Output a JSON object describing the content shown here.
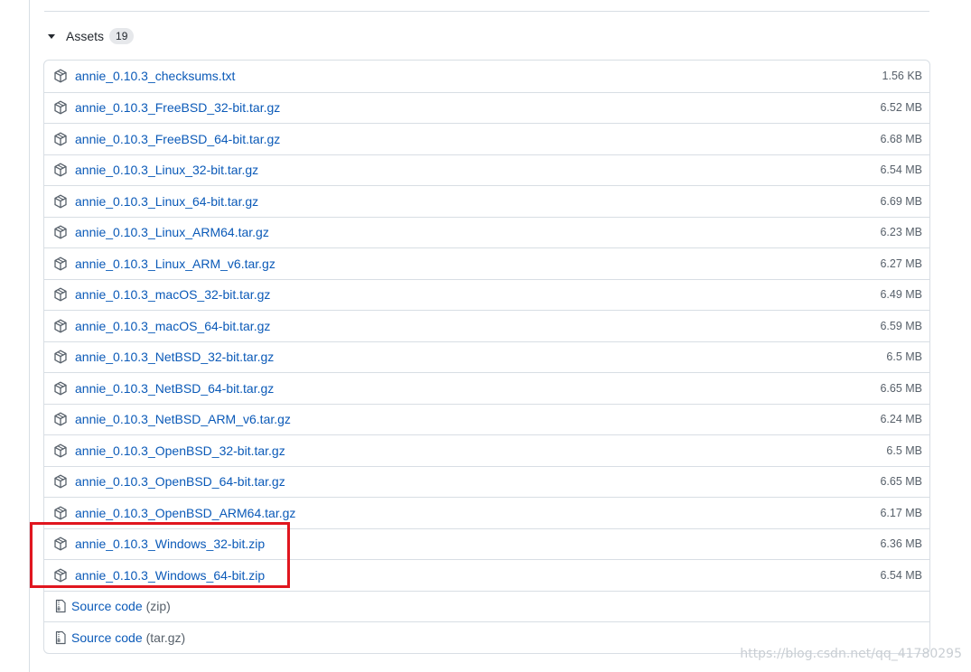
{
  "assets": {
    "title": "Assets",
    "count": "19",
    "files": [
      {
        "name": "annie_0.10.3_checksums.txt",
        "size": "1.56 KB"
      },
      {
        "name": "annie_0.10.3_FreeBSD_32-bit.tar.gz",
        "size": "6.52 MB"
      },
      {
        "name": "annie_0.10.3_FreeBSD_64-bit.tar.gz",
        "size": "6.68 MB"
      },
      {
        "name": "annie_0.10.3_Linux_32-bit.tar.gz",
        "size": "6.54 MB"
      },
      {
        "name": "annie_0.10.3_Linux_64-bit.tar.gz",
        "size": "6.69 MB"
      },
      {
        "name": "annie_0.10.3_Linux_ARM64.tar.gz",
        "size": "6.23 MB"
      },
      {
        "name": "annie_0.10.3_Linux_ARM_v6.tar.gz",
        "size": "6.27 MB"
      },
      {
        "name": "annie_0.10.3_macOS_32-bit.tar.gz",
        "size": "6.49 MB"
      },
      {
        "name": "annie_0.10.3_macOS_64-bit.tar.gz",
        "size": "6.59 MB"
      },
      {
        "name": "annie_0.10.3_NetBSD_32-bit.tar.gz",
        "size": "6.5 MB"
      },
      {
        "name": "annie_0.10.3_NetBSD_64-bit.tar.gz",
        "size": "6.65 MB"
      },
      {
        "name": "annie_0.10.3_NetBSD_ARM_v6.tar.gz",
        "size": "6.24 MB"
      },
      {
        "name": "annie_0.10.3_OpenBSD_32-bit.tar.gz",
        "size": "6.5 MB"
      },
      {
        "name": "annie_0.10.3_OpenBSD_64-bit.tar.gz",
        "size": "6.65 MB"
      },
      {
        "name": "annie_0.10.3_OpenBSD_ARM64.tar.gz",
        "size": "6.17 MB"
      },
      {
        "name": "annie_0.10.3_Windows_32-bit.zip",
        "size": "6.36 MB"
      },
      {
        "name": "annie_0.10.3_Windows_64-bit.zip",
        "size": "6.54 MB"
      }
    ],
    "source": [
      {
        "label": "Source code",
        "suffix": "(zip)"
      },
      {
        "label": "Source code",
        "suffix": "(tar.gz)"
      }
    ]
  },
  "icons": {
    "package": "package-icon",
    "file_zip": "file-zip-icon",
    "caret": "triangle-down-icon"
  },
  "colors": {
    "link": "#0b5ab8",
    "highlight": "#e0161f"
  },
  "watermark": "https://blog.csdn.net/qq_41780295"
}
